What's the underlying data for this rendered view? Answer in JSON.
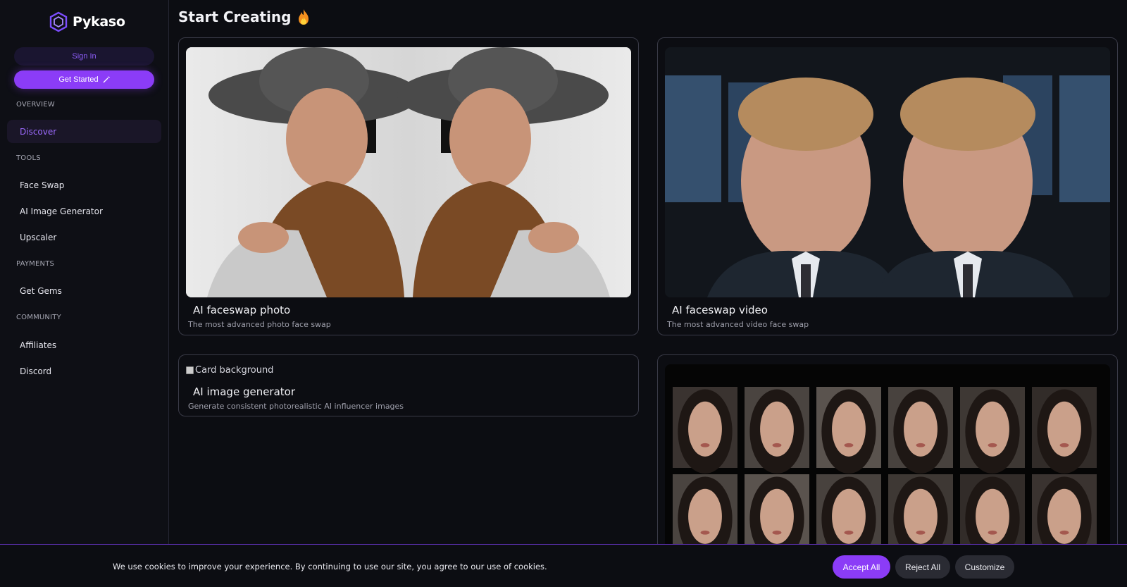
{
  "sidebar": {
    "logo_text": "Pykaso",
    "sign_in_label": "Sign In",
    "get_started_label": "Get Started",
    "sections": {
      "overview": "OVERVIEW",
      "tools": "TOOLS",
      "payments": "PAYMENTS",
      "community": "COMMUNITY"
    },
    "items": {
      "discover": "Discover",
      "face_swap": "Face Swap",
      "ai_image_generator": "AI Image Generator",
      "upscaler": "Upscaler",
      "get_gems": "Get Gems",
      "affiliates": "Affiliates",
      "discord": "Discord"
    }
  },
  "main": {
    "title": "Start Creating",
    "cards": [
      {
        "title": "AI faceswap photo",
        "subtitle": "The most advanced photo face swap"
      },
      {
        "title": "AI faceswap video",
        "subtitle": "The most advanced video face swap"
      },
      {
        "title": "AI image generator",
        "subtitle": "Generate consistent photorealistic AI influencer images",
        "image_alt": "Card background"
      }
    ]
  },
  "cookie": {
    "text": "We use cookies to improve your experience. By continuing to use our site, you agree to our use of cookies.",
    "accept_label": "Accept All",
    "reject_label": "Reject All",
    "customize_label": "Customize"
  },
  "colors": {
    "accent": "#8b3cf7",
    "background": "#0c0d12",
    "active_nav_text": "#9d6bff"
  }
}
